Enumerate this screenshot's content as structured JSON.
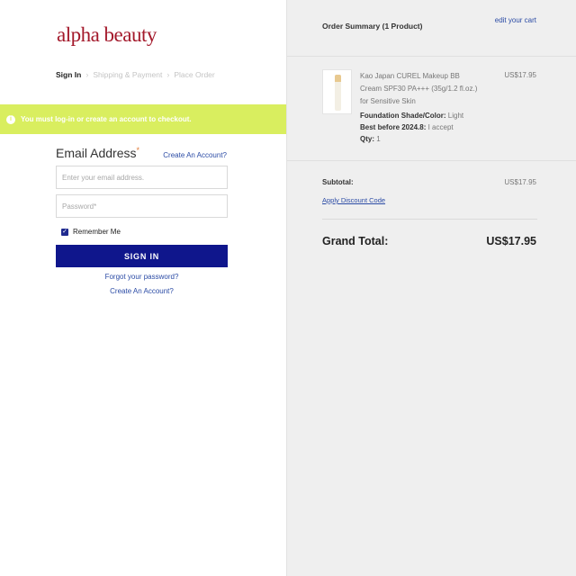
{
  "logo": {
    "text": "alpha beauty"
  },
  "steps": [
    {
      "label": "Sign In"
    },
    {
      "label": "Shipping & Payment"
    },
    {
      "label": "Place Order"
    }
  ],
  "step_separator": "›",
  "notice": {
    "icon": "info-icon",
    "message": "You must log-in or create an account to checkout.",
    "color": "#d9ee5f"
  },
  "login": {
    "heading": "Email Address",
    "required_mark": "*",
    "create_account_link": "Create An Account?",
    "email_placeholder": "Enter your email address.",
    "password_placeholder": "Password*",
    "remember_me": "Remember Me",
    "remember_checked": true,
    "signin_button": "SIGN IN",
    "signin_color": "#0f168c",
    "forgot_password": "Forgot your password?",
    "create_account_bottom": "Create An Account?"
  },
  "summary": {
    "title": "Order Summary (1 Product)",
    "edit_cart": "edit your cart",
    "product": {
      "name": "Kao Japan CUREL Makeup BB Cream SPF30 PA+++ (35g/1.2 fl.oz.) for Sensitive Skin",
      "price": "US$17.95",
      "shade_label": "Foundation Shade/Color:",
      "shade_value": "Light",
      "best_label": "Best before 2024.8:",
      "best_value": "I accept",
      "qty_label": "Qty:",
      "qty_value": "1"
    },
    "subtotal_label": "Subtotal:",
    "subtotal_value": "US$17.95",
    "discount_link": "Apply Discount Code",
    "grand_total_label": "Grand Total:",
    "grand_total_value": "US$17.95"
  }
}
